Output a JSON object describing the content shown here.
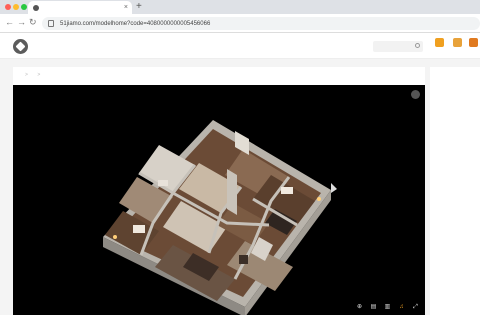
{
  "browser": {
    "tab_title": "",
    "tab_close": "×",
    "new_tab": "+",
    "url": "51jiamo.com/modelhome?code=4080000000005456066",
    "back": "←",
    "forward": "→",
    "reload": "↻"
  },
  "header": {
    "brand": "",
    "slogan": "",
    "nav": [
      "",
      "",
      "",
      "",
      "",
      ""
    ],
    "search_placeholder": "",
    "icons": [
      {
        "label": "",
        "color": "#f0a020"
      },
      {
        "label": "",
        "color": "#e8a23a"
      },
      {
        "label": "",
        "color": "#e07a20"
      }
    ]
  },
  "breadcrumb": [
    "",
    "",
    ""
  ],
  "viewer": {
    "title": "",
    "controls": [
      "⊕",
      "▤",
      "▥",
      "♫",
      "⤢"
    ]
  },
  "side": {
    "title": "",
    "rows": [
      {
        "label": "",
        "value": ""
      },
      {
        "label": "",
        "value": ""
      },
      {
        "label": "",
        "value": ""
      },
      {
        "label": "",
        "value": ""
      },
      {
        "label": "",
        "value": ""
      },
      {
        "label": "",
        "value": ""
      }
    ]
  },
  "colors": {
    "accent": "#f0a020",
    "viewer_bg": "#000000",
    "page_bg": "#f4f4f4"
  }
}
